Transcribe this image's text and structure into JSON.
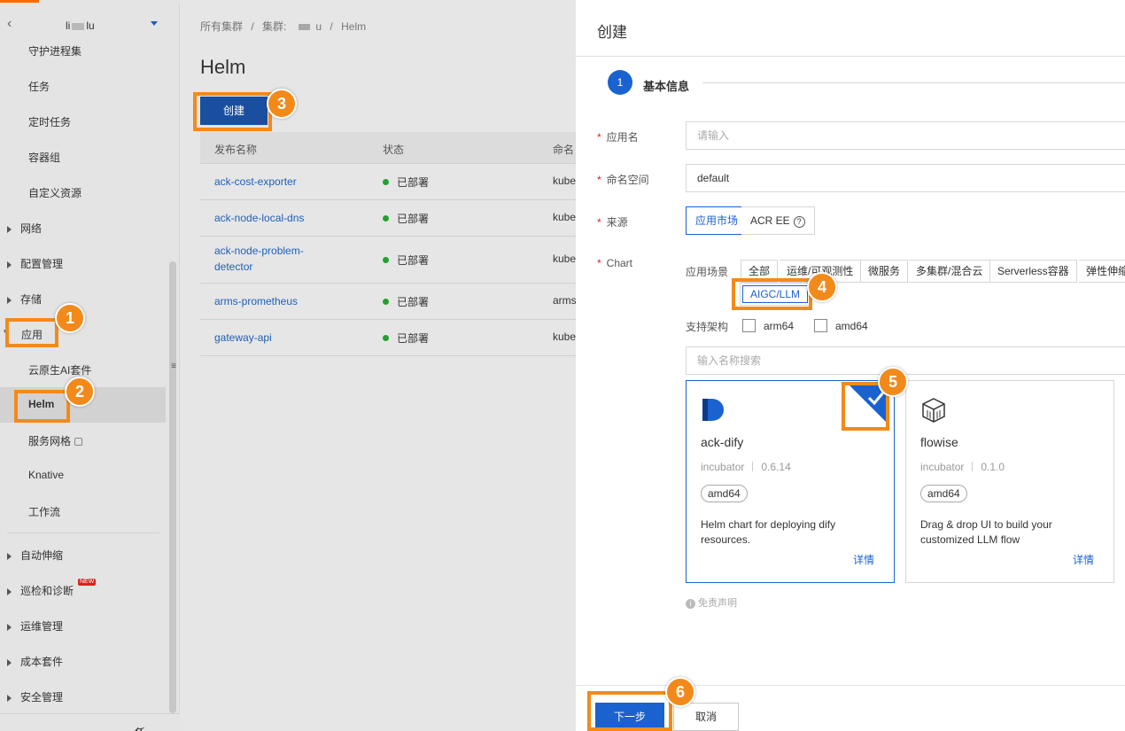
{
  "sidebar": {
    "back_icon": "chevron-left-icon",
    "cluster_name_prefix": "li",
    "cluster_name_suffix": "lu",
    "items": [
      {
        "label": "守护进程集"
      },
      {
        "label": "任务"
      },
      {
        "label": "定时任务"
      },
      {
        "label": "容器组"
      },
      {
        "label": "自定义资源"
      }
    ],
    "groups": [
      {
        "label": "网络"
      },
      {
        "label": "配置管理"
      },
      {
        "label": "存储"
      }
    ],
    "app_group": "应用",
    "app_items": [
      {
        "label": "云原生AI套件"
      },
      {
        "label": "Helm"
      },
      {
        "label": "服务网格"
      },
      {
        "label": "Knative"
      },
      {
        "label": "工作流"
      }
    ],
    "lower_groups": [
      {
        "label": "自动伸缩"
      },
      {
        "label": "巡检和诊断"
      },
      {
        "label": "运维管理"
      },
      {
        "label": "成本套件"
      },
      {
        "label": "安全管理"
      }
    ],
    "new_badge": "NEW",
    "bottom_label": "任务"
  },
  "main": {
    "breadcrumb": {
      "root": "所有集群",
      "sep": "/",
      "cluster_prefix": "集群:",
      "cluster_suffix": "u",
      "current": "Helm"
    },
    "title": "Helm",
    "create_label": "创建",
    "table": {
      "headers": [
        "发布名称",
        "状态",
        "命名"
      ],
      "rows": [
        {
          "name": "ack-cost-exporter",
          "status": "已部署",
          "ns": "kube"
        },
        {
          "name": "ack-node-local-dns",
          "status": "已部署",
          "ns": "kube"
        },
        {
          "name": "ack-node-problem-detector",
          "status": "已部署",
          "ns": "kube"
        },
        {
          "name": "arms-prometheus",
          "status": "已部署",
          "ns": "arms"
        },
        {
          "name": "gateway-api",
          "status": "已部署",
          "ns": "kube"
        }
      ]
    }
  },
  "drawer": {
    "title": "创建",
    "step": {
      "number": "1",
      "label": "基本信息"
    },
    "fields": {
      "app_name": {
        "label": "应用名",
        "placeholder": "请输入"
      },
      "namespace": {
        "label": "命名空间",
        "value": "default"
      },
      "source": {
        "label": "来源",
        "options": [
          "应用市场",
          "ACR EE"
        ]
      },
      "chart": {
        "label": "Chart"
      }
    },
    "scene_label": "应用场景",
    "scene_tabs": [
      "全部",
      "运维/可观测性",
      "微服务",
      "多集群/混合云",
      "Serverless容器",
      "弹性伸缩"
    ],
    "scene_selected": "AIGC/LLM",
    "arch_label": "支持架构",
    "arch_options": [
      "arm64",
      "amd64"
    ],
    "search_placeholder": "输入名称搜索",
    "cards": [
      {
        "name": "ack-dify",
        "repo": "incubator",
        "version": "0.6.14",
        "tag": "amd64",
        "desc": "Helm chart for deploying dify resources.",
        "link": "详情",
        "icon": "dify-logo-icon"
      },
      {
        "name": "flowise",
        "repo": "incubator",
        "version": "0.1.0",
        "tag": "amd64",
        "desc": "Drag & drop UI to build your customized LLM flow",
        "link": "详情",
        "icon": "flowise-cube-icon"
      }
    ],
    "disclaimer": "免责声明",
    "next_label": "下一步",
    "cancel_label": "取消"
  },
  "annotations": [
    "1",
    "2",
    "3",
    "4",
    "5",
    "6"
  ],
  "colors": {
    "accent": "#1a62d0",
    "annotation": "#f28a1b",
    "brand": "#ff6a00",
    "status_ok": "#23a12d"
  }
}
